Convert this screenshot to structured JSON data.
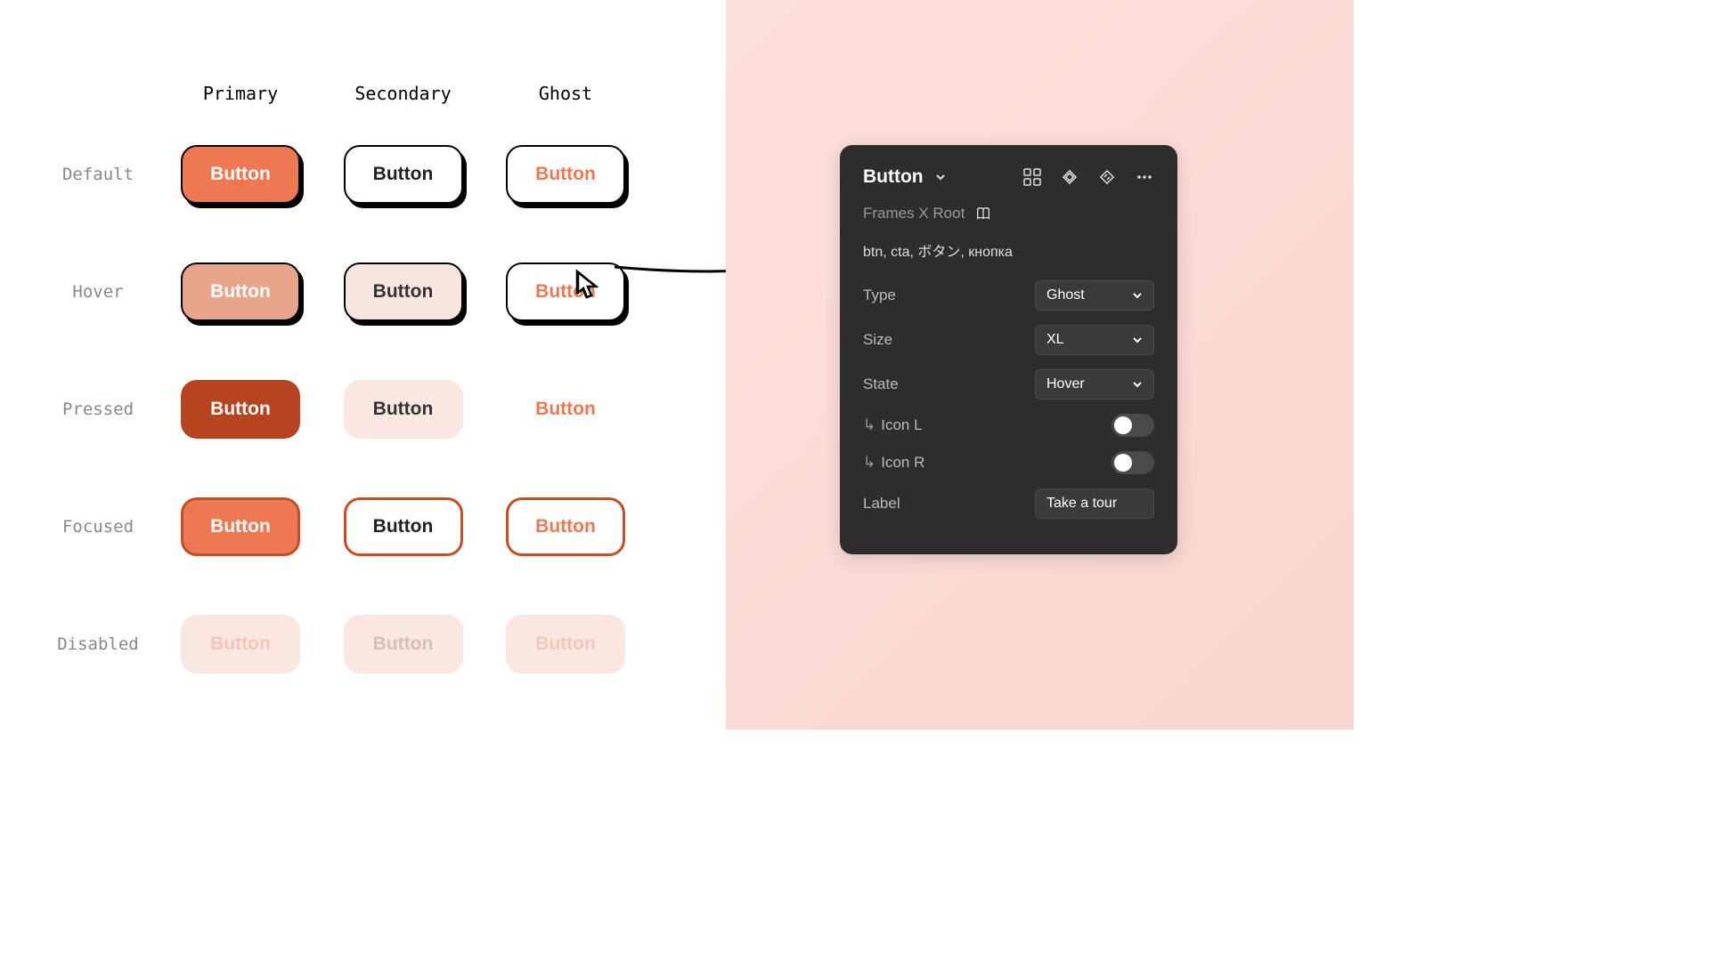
{
  "columns": [
    "Primary",
    "Secondary",
    "Ghost"
  ],
  "rows": [
    "Default",
    "Hover",
    "Pressed",
    "Focused",
    "Disabled"
  ],
  "button_label": "Button",
  "panel": {
    "title": "Button",
    "subtitle": "Frames X Root",
    "description": "btn, cta, ボタン, кнопка",
    "props": {
      "type": {
        "label": "Type",
        "value": "Ghost"
      },
      "size": {
        "label": "Size",
        "value": "XL"
      },
      "state": {
        "label": "State",
        "value": "Hover"
      },
      "icon_l": {
        "label": "Icon L",
        "value": false
      },
      "icon_r": {
        "label": "Icon R",
        "value": false
      },
      "label_prop": {
        "label": "Label",
        "value": "Take a tour"
      }
    }
  }
}
